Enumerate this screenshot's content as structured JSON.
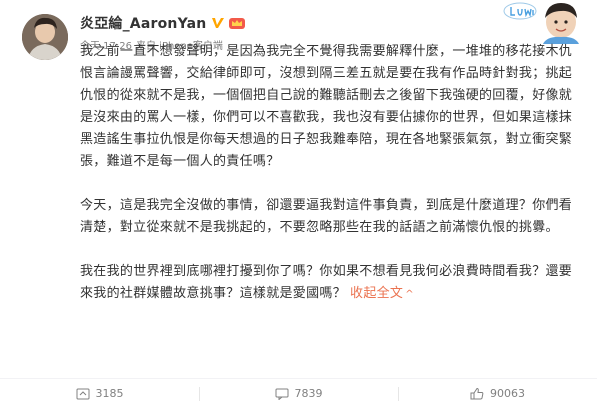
{
  "post": {
    "username": "炎亞綸_AaronYan",
    "timestamp": "今天 17:26",
    "source": "来自 iPhone客户端",
    "paragraphs": [
      "我之前一直不想發聲明，是因為我完全不覺得我需要解釋什麼，一堆堆的移花接木仇恨言論謾罵聲響，交給律師即可，沒想到隔三差五就是要在我有作品時針對我；挑起仇恨的從來就不是我，一個個把自己說的難聽話刪去之後留下我強硬的回覆，好像就是沒來由的罵人一樣，你們可以不喜歡我，我也沒有要佔據你的世界，但如果這樣抹黑造謠生事拉仇恨是你每天想過的日子恕我難奉陪，現在各地緊張氣氛，對立衝突緊張，難道不是每一個人的責任嗎？",
      "今天，這是我完全沒做的事情，卻還要逼我對這件事負責，到底是什麼道理？你們看清楚，對立從來就不是我挑起的，不要忽略那些在我的話語之前滿懷仇恨的挑釁。",
      "我在我的世界裡到底哪裡打擾到你了嗎？你如果不想看見我何必浪費時間看我？還要來我的社群媒體故意挑事？這樣就是愛國嗎？"
    ],
    "collapse_label": "收起全文",
    "collapse_arrow": "^"
  },
  "footer": {
    "repost_count": "3185",
    "comment_count": "7839",
    "like_count": "90063"
  },
  "colors": {
    "accent": "#eb7350",
    "verified": "#ffa500",
    "meta": "#808080",
    "text": "#333333"
  },
  "icons": {
    "verified": "verified-v-icon",
    "member": "member-crown-icon",
    "repost": "repost-icon",
    "comment": "comment-icon",
    "like": "thumbs-up-icon"
  }
}
